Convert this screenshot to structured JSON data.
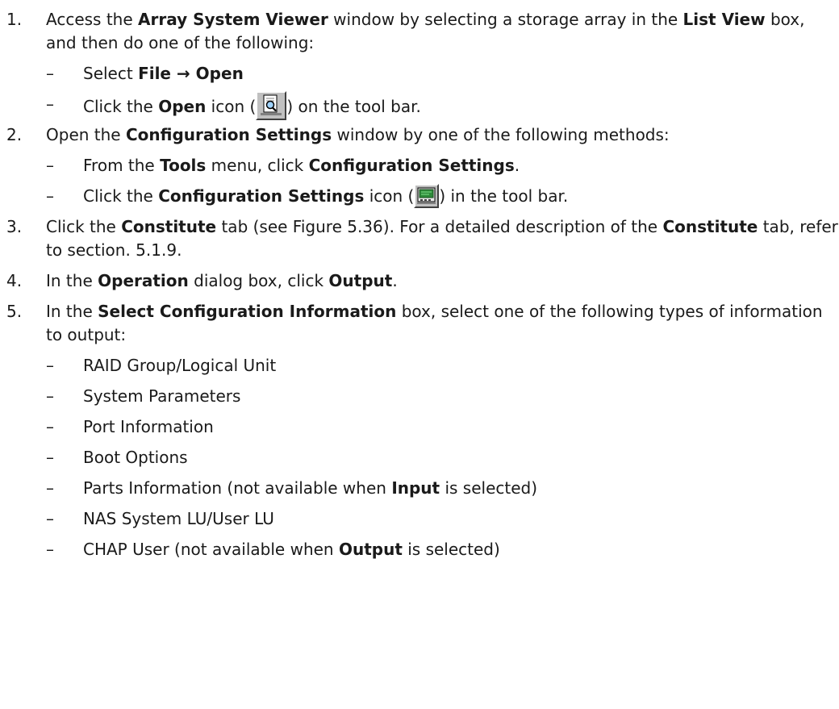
{
  "steps": [
    {
      "num": "1.",
      "parts": [
        {
          "t": "Access the ",
          "b": false
        },
        {
          "t": "Array System Viewer",
          "b": true
        },
        {
          "t": " window by selecting a storage array in the ",
          "b": false
        },
        {
          "t": "List View",
          "b": true
        },
        {
          "t": " box, and then do one of the following:",
          "b": false
        }
      ],
      "subs": [
        [
          {
            "t": "Select ",
            "b": false
          },
          {
            "t": "File → Open",
            "b": true
          }
        ],
        [
          {
            "t": "Click the ",
            "b": false
          },
          {
            "t": "Open",
            "b": true
          },
          {
            "t": " icon (",
            "b": false
          },
          {
            "icon": "open-icon"
          },
          {
            "t": ") on the tool bar.",
            "b": false
          }
        ]
      ]
    },
    {
      "num": "2.",
      "parts": [
        {
          "t": "Open the ",
          "b": false
        },
        {
          "t": "Configuration Settings",
          "b": true
        },
        {
          "t": " window by one of the following methods:",
          "b": false
        }
      ],
      "subs": [
        [
          {
            "t": "From the ",
            "b": false
          },
          {
            "t": "Tools",
            "b": true
          },
          {
            "t": " menu, click ",
            "b": false
          },
          {
            "t": "Configuration Settings",
            "b": true
          },
          {
            "t": ".",
            "b": false
          }
        ],
        [
          {
            "t": "Click the ",
            "b": false
          },
          {
            "t": "Configuration Settings",
            "b": true
          },
          {
            "t": " icon (",
            "b": false
          },
          {
            "icon": "configuration-settings-icon"
          },
          {
            "t": ") in the tool bar.",
            "b": false
          }
        ]
      ]
    },
    {
      "num": "3.",
      "parts": [
        {
          "t": "Click the ",
          "b": false
        },
        {
          "t": "Constitute",
          "b": true
        },
        {
          "t": " tab (see Figure 5.36). For a detailed description of the ",
          "b": false
        },
        {
          "t": "Constitute",
          "b": true
        },
        {
          "t": " tab, refer to section. 5.1.9.",
          "b": false
        }
      ],
      "subs": []
    },
    {
      "num": "4.",
      "parts": [
        {
          "t": "In the ",
          "b": false
        },
        {
          "t": "Operation",
          "b": true
        },
        {
          "t": " dialog box, click ",
          "b": false
        },
        {
          "t": "Output",
          "b": true
        },
        {
          "t": ".",
          "b": false
        }
      ],
      "subs": []
    },
    {
      "num": "5.",
      "parts": [
        {
          "t": "In the ",
          "b": false
        },
        {
          "t": "Select Configuration Information",
          "b": true
        },
        {
          "t": " box, select one of the following types of information to output:",
          "b": false
        }
      ],
      "subs": [
        [
          {
            "t": "RAID Group/Logical Unit",
            "b": false
          }
        ],
        [
          {
            "t": "System Parameters",
            "b": false
          }
        ],
        [
          {
            "t": "Port Information",
            "b": false
          }
        ],
        [
          {
            "t": "Boot Options",
            "b": false
          }
        ],
        [
          {
            "t": "Parts Information (not available when ",
            "b": false
          },
          {
            "t": "Input",
            "b": true
          },
          {
            "t": " is selected)",
            "b": false
          }
        ],
        [
          {
            "t": "NAS System LU/User LU",
            "b": false
          }
        ],
        [
          {
            "t": "CHAP User (not available when ",
            "b": false
          },
          {
            "t": "Output",
            "b": true
          },
          {
            "t": " is selected)",
            "b": false
          }
        ]
      ]
    }
  ],
  "dash": "–",
  "colors": {
    "text": "#1a1a1a",
    "icon_face": "#c0c0c0"
  }
}
